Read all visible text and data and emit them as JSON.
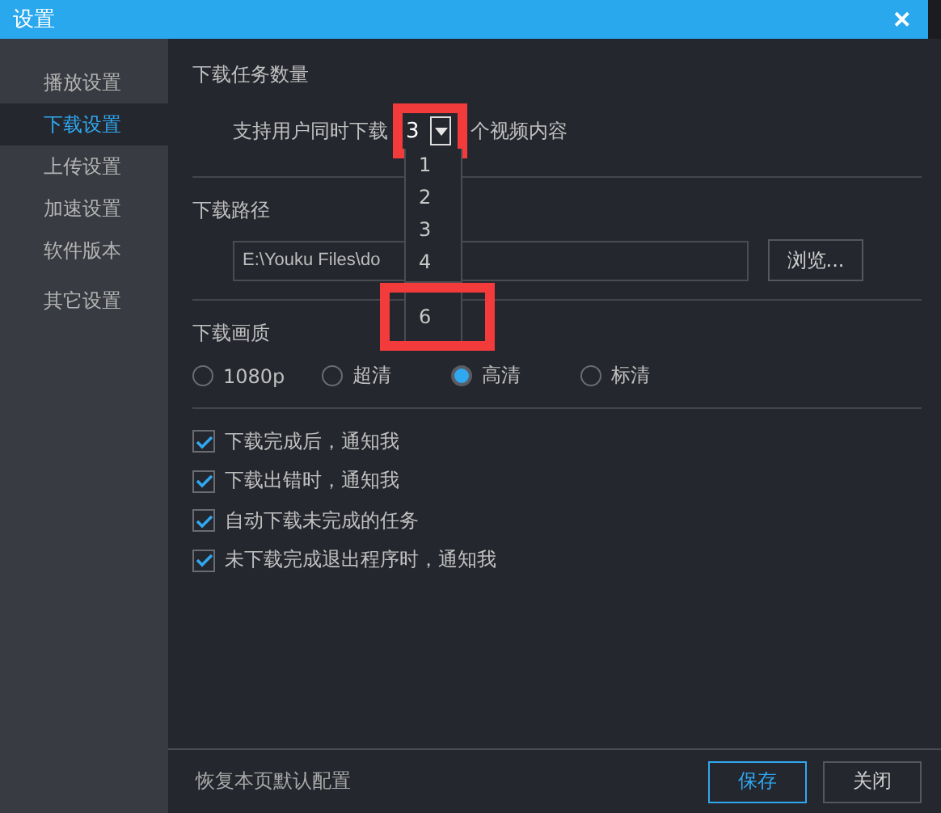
{
  "window": {
    "title": "设置",
    "close": "✕"
  },
  "sidebar": {
    "items": [
      {
        "label": "播放设置",
        "selected": false
      },
      {
        "label": "下载设置",
        "selected": true
      },
      {
        "label": "上传设置",
        "selected": false
      },
      {
        "label": "加速设置",
        "selected": false
      },
      {
        "label": "软件版本",
        "selected": false
      },
      {
        "label": "其它设置",
        "selected": false
      }
    ]
  },
  "task_count": {
    "heading": "下载任务数量",
    "prefix": "支持用户同时下载",
    "value": "3",
    "suffix": "个视频内容",
    "options": [
      "1",
      "2",
      "3",
      "4"
    ],
    "highlighted_option": "6"
  },
  "path": {
    "heading": "下载路径",
    "value": "E:\\Youku Files\\do",
    "browse": "浏览..."
  },
  "quality": {
    "heading": "下载画质",
    "options": [
      {
        "label": "1080p",
        "selected": false
      },
      {
        "label": "超清",
        "selected": false
      },
      {
        "label": "高清",
        "selected": true
      },
      {
        "label": "标清",
        "selected": false
      }
    ]
  },
  "notifications": [
    {
      "label": "下载完成后，通知我",
      "checked": true
    },
    {
      "label": "下载出错时，通知我",
      "checked": true
    },
    {
      "label": "自动下载未完成的任务",
      "checked": true
    },
    {
      "label": "未下载完成退出程序时，通知我",
      "checked": true
    }
  ],
  "footer": {
    "restore": "恢复本页默认配置",
    "buttons": [
      {
        "label": "保存",
        "kind": "primary"
      },
      {
        "label": "关闭",
        "kind": "secondary"
      }
    ]
  }
}
